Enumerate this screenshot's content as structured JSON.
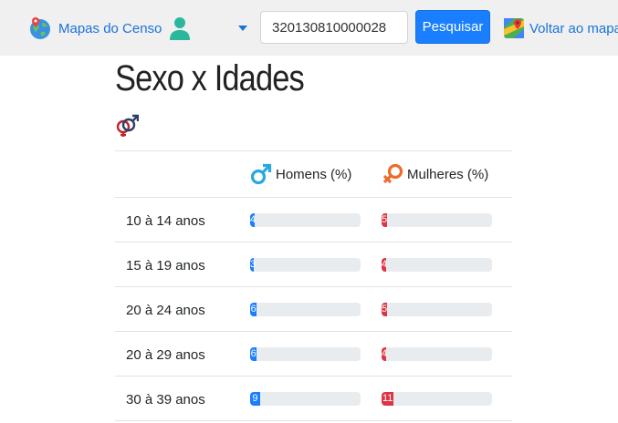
{
  "navbar": {
    "brand_label": "Mapas do Censo",
    "brand_icon": "globe-pin-icon",
    "user_icon": "person-icon",
    "search_value": "320130810000028",
    "search_button_label": "Pesquisar",
    "back_label": "Voltar ao mapa",
    "back_icon": "google-maps-icon",
    "colors": {
      "navbar_bg": "#f0f0f0",
      "link": "#1a73d9",
      "primary": "#1a7fff",
      "user_icon": "#2bb89a"
    }
  },
  "page": {
    "title": "Sexo x Idades",
    "title_icon": "male-female-icon"
  },
  "table": {
    "headers": {
      "label": "",
      "men": "Homens (%)",
      "women": "Mulheres (%)"
    },
    "men_icon": "male-symbol-icon",
    "women_icon": "female-symbol-icon",
    "colors": {
      "men": "#1a7fff",
      "women": "#dc3545",
      "men_symbol": "#2aa8e0",
      "women_symbol": "#f06a2a"
    },
    "rows": [
      {
        "label": "10 à 14 anos",
        "men": "4",
        "women": "5",
        "men_value": 4,
        "women_value": 5
      },
      {
        "label": "15 à 19 anos",
        "men": "3",
        "women": "4",
        "men_value": 3,
        "women_value": 4
      },
      {
        "label": "20 à 24 anos",
        "men": "6",
        "women": "5",
        "men_value": 6,
        "women_value": 5
      },
      {
        "label": "20 à 29 anos",
        "men": "6",
        "women": "4",
        "men_value": 6,
        "women_value": 4
      },
      {
        "label": "30 à 39 anos",
        "men": "9",
        "women": "11",
        "men_value": 9,
        "women_value": 11
      }
    ]
  }
}
